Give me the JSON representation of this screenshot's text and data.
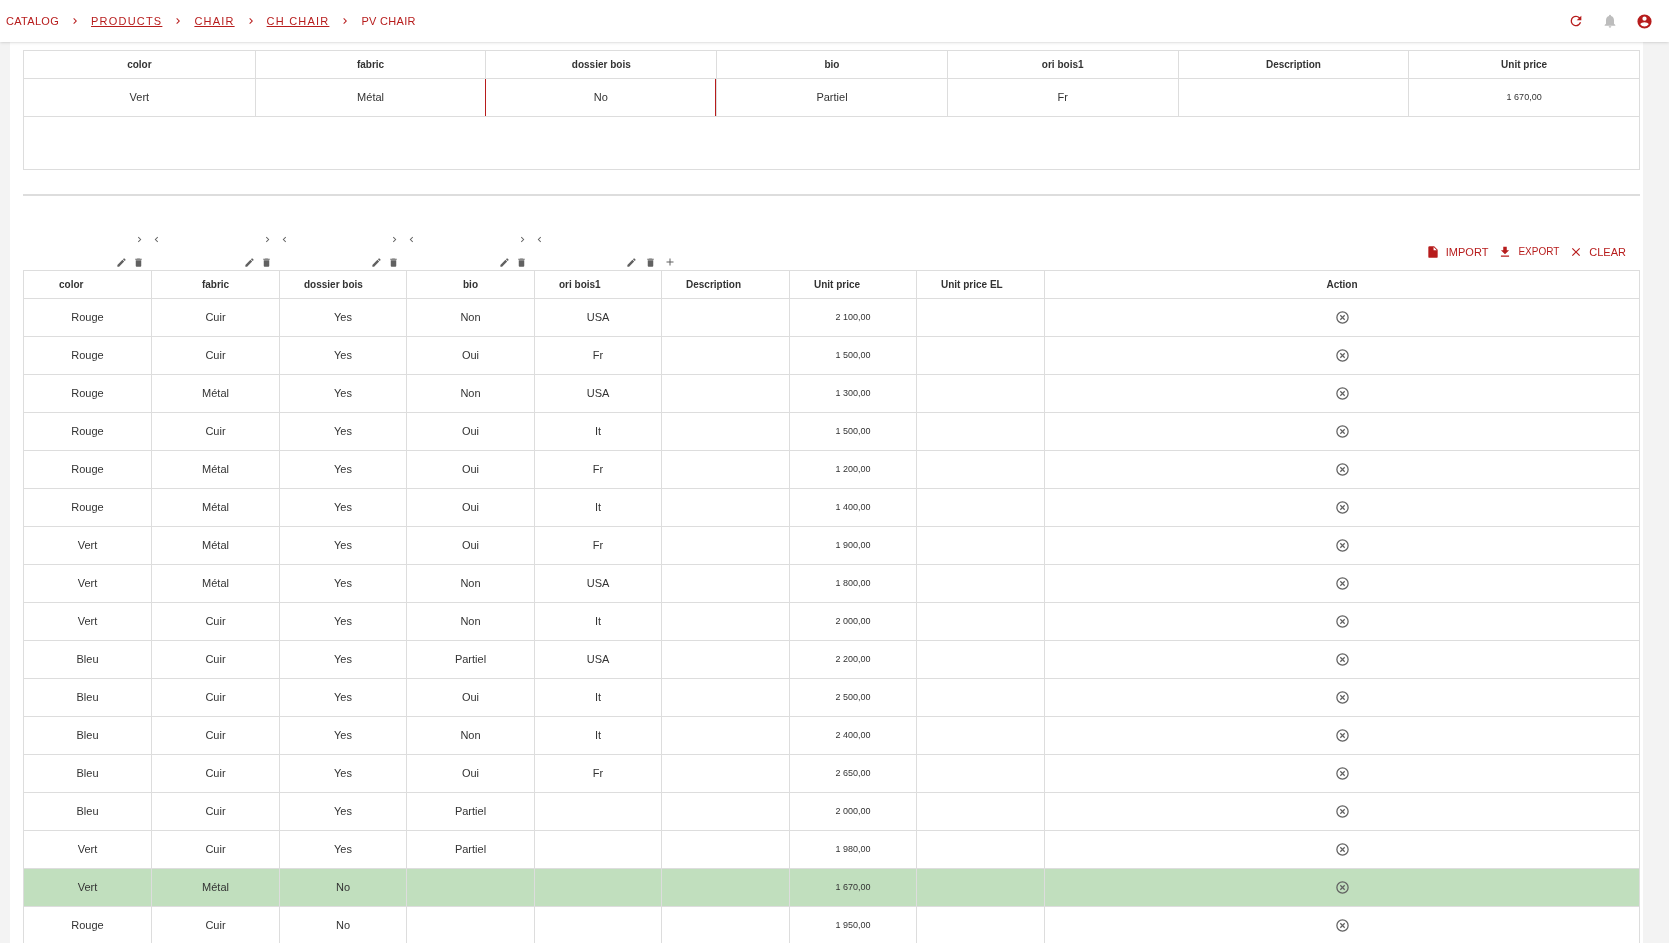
{
  "breadcrumb": [
    {
      "label": "CATALOG",
      "link": false
    },
    {
      "label": "PRODUCTS",
      "link": true
    },
    {
      "label": "CHAIR",
      "link": true
    },
    {
      "label": "CH CHAIR",
      "link": true
    },
    {
      "label": "PV CHAIR",
      "link": false
    }
  ],
  "top_table": {
    "columns": [
      "color",
      "fabric",
      "dossier bois",
      "bio",
      "ori bois1",
      "Description",
      "Unit price"
    ],
    "row": [
      {
        "text": "Vert",
        "flagged": false
      },
      {
        "text": "Métal",
        "flagged": false
      },
      {
        "text": "No",
        "flagged": true
      },
      {
        "text": "Partiel",
        "flagged": false
      },
      {
        "text": "Fr",
        "flagged": false
      },
      {
        "flagged": false
      },
      {
        "text": "1 670,00",
        "flagged": false
      }
    ]
  },
  "actions": [
    "IMPORT",
    "EXPORT",
    "CLEAR"
  ],
  "table": {
    "columns": [
      "color",
      "fabric",
      "dossier bois",
      "bio",
      "ori bois1",
      "Description",
      "Unit price",
      "Unit price EL",
      "Action"
    ],
    "rows": [
      {
        "color_name": "Rouge",
        "fabric": "Cuir",
        "dossier_bois": "Yes",
        "bio": "Non",
        "ori_bois1": "USA",
        "unit_price": "2 100,00",
        "selected": false
      },
      {
        "color_name": "Rouge",
        "fabric": "Cuir",
        "dossier_bois": "Yes",
        "bio": "Oui",
        "ori_bois1": "Fr",
        "unit_price": "1 500,00",
        "selected": false
      },
      {
        "color_name": "Rouge",
        "fabric": "Métal",
        "dossier_bois": "Yes",
        "bio": "Non",
        "ori_bois1": "USA",
        "unit_price": "1 300,00",
        "selected": false
      },
      {
        "color_name": "Rouge",
        "fabric": "Cuir",
        "dossier_bois": "Yes",
        "bio": "Oui",
        "ori_bois1": "It",
        "unit_price": "1 500,00",
        "selected": false
      },
      {
        "color_name": "Rouge",
        "fabric": "Métal",
        "dossier_bois": "Yes",
        "bio": "Oui",
        "ori_bois1": "Fr",
        "unit_price": "1 200,00",
        "selected": false
      },
      {
        "color_name": "Rouge",
        "fabric": "Métal",
        "dossier_bois": "Yes",
        "bio": "Oui",
        "ori_bois1": "It",
        "unit_price": "1 400,00",
        "selected": false
      },
      {
        "color_name": "Vert",
        "fabric": "Métal",
        "dossier_bois": "Yes",
        "bio": "Oui",
        "ori_bois1": "Fr",
        "unit_price": "1 900,00",
        "selected": false
      },
      {
        "color_name": "Vert",
        "fabric": "Métal",
        "dossier_bois": "Yes",
        "bio": "Non",
        "ori_bois1": "USA",
        "unit_price": "1 800,00",
        "selected": false
      },
      {
        "color_name": "Vert",
        "fabric": "Cuir",
        "dossier_bois": "Yes",
        "bio": "Non",
        "ori_bois1": "It",
        "unit_price": "2 000,00",
        "selected": false
      },
      {
        "color_name": "Bleu",
        "fabric": "Cuir",
        "dossier_bois": "Yes",
        "bio": "Partiel",
        "ori_bois1": "USA",
        "unit_price": "2 200,00",
        "selected": false
      },
      {
        "color_name": "Bleu",
        "fabric": "Cuir",
        "dossier_bois": "Yes",
        "bio": "Oui",
        "ori_bois1": "It",
        "unit_price": "2 500,00",
        "selected": false
      },
      {
        "color_name": "Bleu",
        "fabric": "Cuir",
        "dossier_bois": "Yes",
        "bio": "Non",
        "ori_bois1": "It",
        "unit_price": "2 400,00",
        "selected": false
      },
      {
        "color_name": "Bleu",
        "fabric": "Cuir",
        "dossier_bois": "Yes",
        "bio": "Oui",
        "ori_bois1": "Fr",
        "unit_price": "2 650,00",
        "selected": false
      },
      {
        "color_name": "Bleu",
        "fabric": "Cuir",
        "dossier_bois": "Yes",
        "bio": "Partiel",
        "unit_price": "2 000,00",
        "selected": false
      },
      {
        "color_name": "Vert",
        "fabric": "Cuir",
        "dossier_bois": "Yes",
        "bio": "Partiel",
        "unit_price": "1 980,00",
        "selected": false
      },
      {
        "color_name": "Vert",
        "fabric": "Métal",
        "dossier_bois": "No",
        "unit_price": "1 670,00",
        "selected": true
      },
      {
        "color_name": "Rouge",
        "fabric": "Cuir",
        "dossier_bois": "No",
        "unit_price": "1 950,00",
        "selected": false
      }
    ]
  }
}
